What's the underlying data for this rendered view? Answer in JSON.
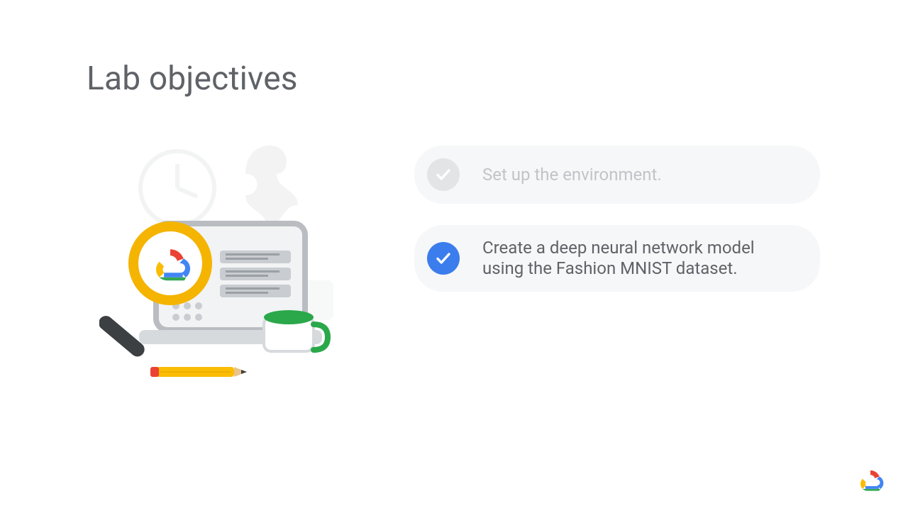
{
  "title": "Lab objectives",
  "objectives": [
    {
      "label": "Set up the environment.",
      "state": "inactive"
    },
    {
      "label": "Create a deep neural network model using the Fashion MNIST dataset.",
      "state": "active"
    }
  ],
  "icons": {
    "check": "check-icon",
    "illustration": "lab-illustration",
    "brand": "google-cloud-logo"
  },
  "colors": {
    "accent_blue": "#3b7ded",
    "text_grey": "#5f6368",
    "muted_grey": "#c1c4c8",
    "pill_bg": "#f6f7f8"
  }
}
